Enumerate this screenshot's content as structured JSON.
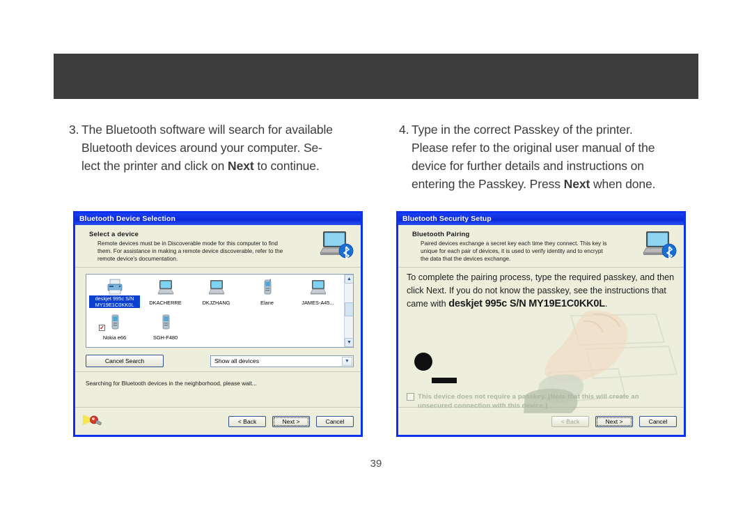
{
  "page": {
    "number": "39"
  },
  "instructions": [
    {
      "number": "3.",
      "line1": "The Bluetooth software will search for available",
      "line2": "Bluetooth devices around your computer.  Se-",
      "line3_pre": "lect the printer and click on ",
      "line3_bold": "Next",
      "line3_post": " to continue."
    },
    {
      "number": "4.",
      "line1": "Type in the correct Passkey of the printer.",
      "line2": "Please refer to the original user manual of the",
      "line3": "device for further details and instructions on",
      "line4_pre": "entering the Passkey.  Press ",
      "line4_bold": "Next",
      "line4_post": " when done."
    }
  ],
  "dialog_left": {
    "title": "Bluetooth Device Selection",
    "heading": "Select a device",
    "description": "Remote devices must be in Discoverable mode for this computer to find them. For assistance in making a remote device discoverable, refer to the remote device's documentation.",
    "head_icon": "laptop-bluetooth-icon",
    "devices": [
      {
        "label": "deskjet 995c S/N MY19E1C0KK0L",
        "icon": "printer-icon",
        "selected": true,
        "checked": false
      },
      {
        "label": "DKACHERRE",
        "icon": "computer-icon",
        "selected": false,
        "checked": false
      },
      {
        "label": "DKJZHANG",
        "icon": "computer-icon",
        "selected": false,
        "checked": false
      },
      {
        "label": "Elane",
        "icon": "phone-icon",
        "selected": false,
        "checked": false
      },
      {
        "label": "JAMES-A45...",
        "icon": "computer-icon",
        "selected": false,
        "checked": false
      },
      {
        "label": "Nokia e66",
        "icon": "phone-icon",
        "selected": false,
        "checked": true
      },
      {
        "label": "SGH-F480",
        "icon": "phone-icon",
        "selected": false,
        "checked": false
      }
    ],
    "cancel_search_label": "Cancel Search",
    "filter_value": "Show all devices",
    "status_text": "Searching for Bluetooth devices in the neighborhood, please wait...",
    "footer_icon": "search-flashlight-icon",
    "back_label": "< Back",
    "next_label": "Next >",
    "cancel_label": "Cancel",
    "back_disabled": false,
    "next_focused": false
  },
  "dialog_right": {
    "title": "Bluetooth Security Setup",
    "heading": "Bluetooth Pairing",
    "description": "Paired devices exchange a secret key each time they connect. This key is unique for each pair of devices, it is used to verify identity and to encrypt the data that the devices exchange.",
    "head_icon": "laptop-bluetooth-icon",
    "body_text_1": "To complete the pairing process, type the required passkey, and then click Next. If you do not know the passkey, see the instructions that came with ",
    "device_name": "deskjet 995c S/N MY19E1C0KK0L",
    "body_text_2": ".",
    "no_passkey_label": "This device does not require a passkey. [Note that this will create an unsecured connection with this device.]",
    "no_passkey_checked": false,
    "back_label": "< Back",
    "next_label": "Next >",
    "cancel_label": "Cancel",
    "back_disabled": true,
    "next_focused": true
  },
  "colors": {
    "header_band": "#3d3d3d",
    "dialog_border": "#0a30f0",
    "titlebar": "#0b28d8",
    "dialog_bg": "#eeeedc",
    "selection": "#0a3fd0",
    "body_text": "#3b3b3b"
  }
}
